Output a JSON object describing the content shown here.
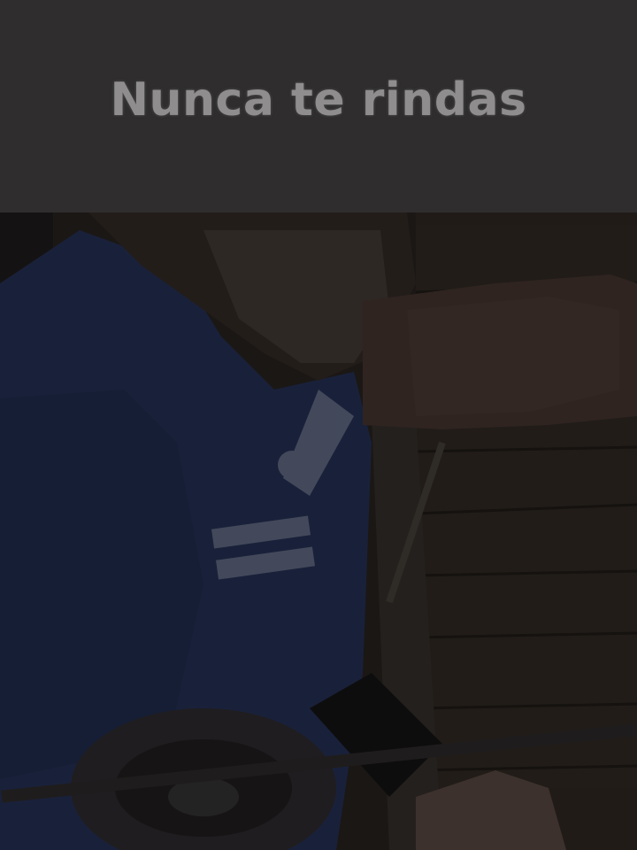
{
  "caption": {
    "text": "Nunca te rindas"
  },
  "photo": {
    "subject": "man-in-blue-tshirt-lifting-weights",
    "colors": {
      "shirt": "#1f2a4a",
      "skin": "#3a2c28",
      "background": "#1e1b19",
      "banner": "#2f2d2d",
      "caption_text": "#8f8d8d"
    }
  }
}
